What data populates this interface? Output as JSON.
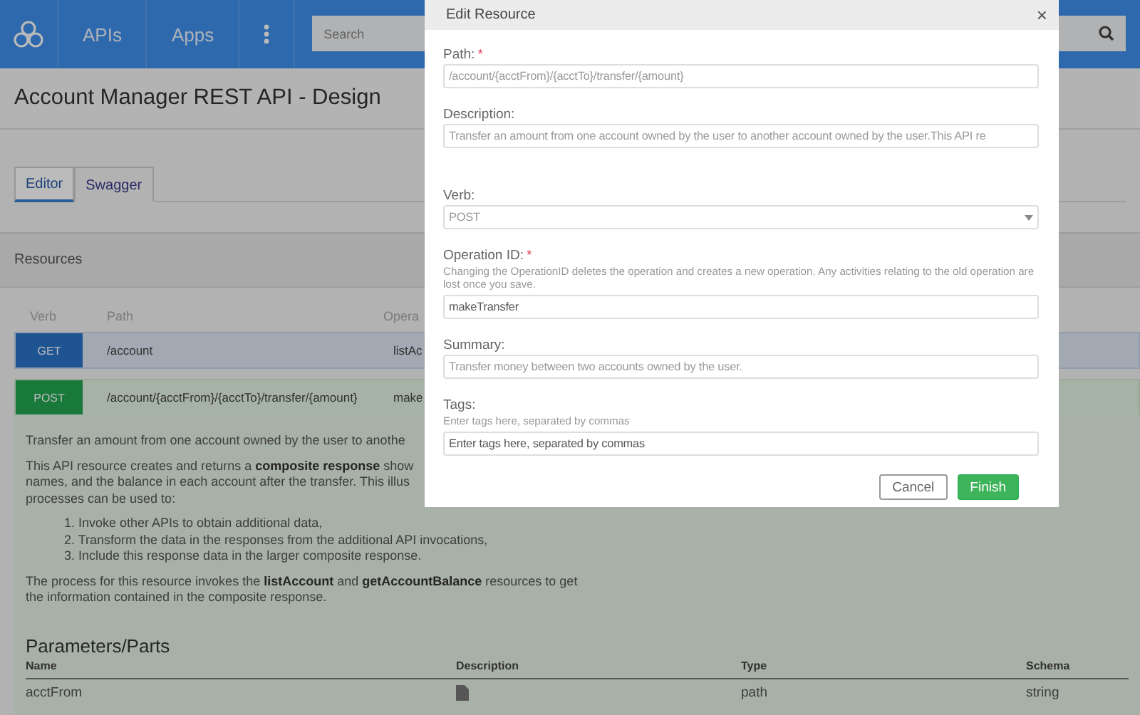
{
  "header": {
    "nav": [
      {
        "label": "APIs"
      },
      {
        "label": "Apps"
      }
    ],
    "search": {
      "placeholder": "Search"
    }
  },
  "page": {
    "title": "Account Manager REST API - Design"
  },
  "tabs": [
    {
      "label": "Editor",
      "selected": true
    },
    {
      "label": "Swagger",
      "selected": false
    }
  ],
  "resources": {
    "title": "Resources",
    "columns": [
      "Verb",
      "Path",
      "Opera"
    ],
    "rows": [
      {
        "verb": "GET",
        "kind": "get",
        "path": "/account",
        "operation": "listAc",
        "expanded": false
      },
      {
        "verb": "POST",
        "kind": "post",
        "path": "/account/{acctFrom}/{acctTo}/transfer/{amount}",
        "operation": "make",
        "expanded": true
      }
    ]
  },
  "details": {
    "paragraphs": [
      [
        "Transfer an amount from one account owned by the user to anothe"
      ],
      [
        "This API resource creates and returns a **composite response** show",
        "names, and the balance in each account after the transfer. This illus",
        "processes can be used to:"
      ]
    ],
    "list": [
      "1. Invoke other APIs to obtain additional data,",
      "2. Transform the data in the responses from the additional API invocations,",
      "3. Include this response data in the larger composite response."
    ],
    "closing": [
      "The process for this resource invokes the **listAccount** and **getAccountBalance** resources to get",
      "the information contained in the composite response."
    ],
    "parameters": {
      "title": "Parameters/Parts",
      "columns": [
        "Name",
        "Description",
        "Type",
        "Schema"
      ],
      "rows": [
        {
          "name": "acctFrom",
          "type": "path",
          "schema": "string"
        }
      ]
    }
  },
  "dialog": {
    "title": "Edit Resource",
    "close": "×",
    "fields": [
      {
        "kind": "text",
        "label": "Path:",
        "mark": "*",
        "value": "/account/{acctFrom}/{acctTo}/transfer/{amount}",
        "disabled": true
      },
      {
        "kind": "text",
        "label": "Description:",
        "value": "Transfer an amount from one account owned by the user to another account owned by the user.This API re",
        "disabled": true
      },
      {
        "kind": "select",
        "label": "Verb:",
        "value": "POST",
        "disabled": true
      },
      {
        "kind": "text",
        "label": "Operation ID:",
        "mark": "*",
        "help": "Changing the OperationID deletes the operation and creates a new operation. Any activities relating to the old operation are lost once you save.",
        "value": "makeTransfer",
        "disabled": false
      },
      {
        "kind": "text",
        "label": "Summary:",
        "value": "Transfer money between two accounts owned by the user.",
        "disabled": true
      },
      {
        "kind": "text",
        "label": "Tags:",
        "help": "Enter tags here, separated by commas",
        "placeholder": "Enter tags here, separated by commas",
        "disabled": false
      }
    ],
    "buttons": [
      {
        "label": "Cancel",
        "kind": "secondary"
      },
      {
        "label": "Finish",
        "kind": "primary"
      }
    ]
  }
}
